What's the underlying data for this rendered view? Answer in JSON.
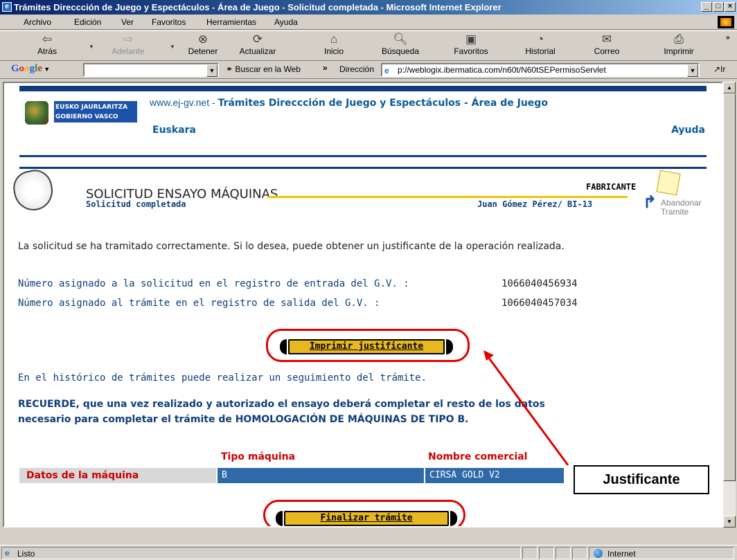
{
  "window": {
    "title": "Trámites Direccción de Juego y Espectáculos - Área de Juego - Solicitud completada - Microsoft Internet Explorer"
  },
  "menu": [
    "Archivo",
    "Edición",
    "Ver",
    "Favoritos",
    "Herramientas",
    "Ayuda"
  ],
  "toolbar": {
    "back": "Atrás",
    "forward": "Adelante",
    "stop": "Detener",
    "refresh": "Actualizar",
    "home": "Inicio",
    "search": "Búsqueda",
    "favorites": "Favoritos",
    "history": "Historial",
    "mail": "Correo",
    "print": "Imprimir"
  },
  "addressbar": {
    "google_label": "Google",
    "google_search_value": "",
    "search_web": "Buscar en la Web",
    "address_label": "Dirección",
    "url": "p://weblogix.ibermatica.com/n60t/N60tSEPermisoServlet",
    "go": "Ir"
  },
  "header": {
    "gov_line1": "EUSKO JAURLARITZA",
    "gov_line2": "GOBIERNO VASCO",
    "site_url": "www.ej-gv.net",
    "site_title": "Trámites Direccción de Juego y Espectáculos - Área de Juego",
    "lang_link": "Euskara",
    "help_link": "Ayuda"
  },
  "page": {
    "title": "SOLICITUD ENSAYO MÁQUINAS",
    "subtitle": "Solicitud completada",
    "role": "FABRICANTE",
    "user": "Juan Gómez Pérez/ BI-13",
    "abandon_line1": "Abandonar",
    "abandon_line2": "Tramite",
    "intro": "La solicitud se ha tramitado correctamente. Si lo desea, puede obtener un justificante de la operación realizada.",
    "entry_label": "Número asignado a la solicitud en el registro de entrada del G.V. :",
    "entry_value": "1066040456934",
    "exit_label": "Número asignado al trámite en el registro de salida del G.V. :",
    "exit_value": "1066040457034",
    "print_button": "Imprimir justificante",
    "history_text": "En el histórico de trámites puede realizar un seguimiento del trámite.",
    "reminder_line1": "RECUERDE, que una vez realizado y autorizado el ensayo deberá completar el resto de los datos",
    "reminder_line2": "necesario para completar el trámite de HOMOLOGACIÓN DE MÁQUINAS  DE TIPO B.",
    "table": {
      "col1": "Tipo máquina",
      "col2": "Nombre comercial",
      "row_label": "Datos de la máquina",
      "tipo": "B",
      "nombre": "CIRSA GOLD V2"
    },
    "finish_button": "Finalizar trámite"
  },
  "annotation": {
    "callout": "Justificante",
    "color": "#e00000"
  },
  "status": {
    "left": "Listo",
    "zone": "Internet"
  }
}
